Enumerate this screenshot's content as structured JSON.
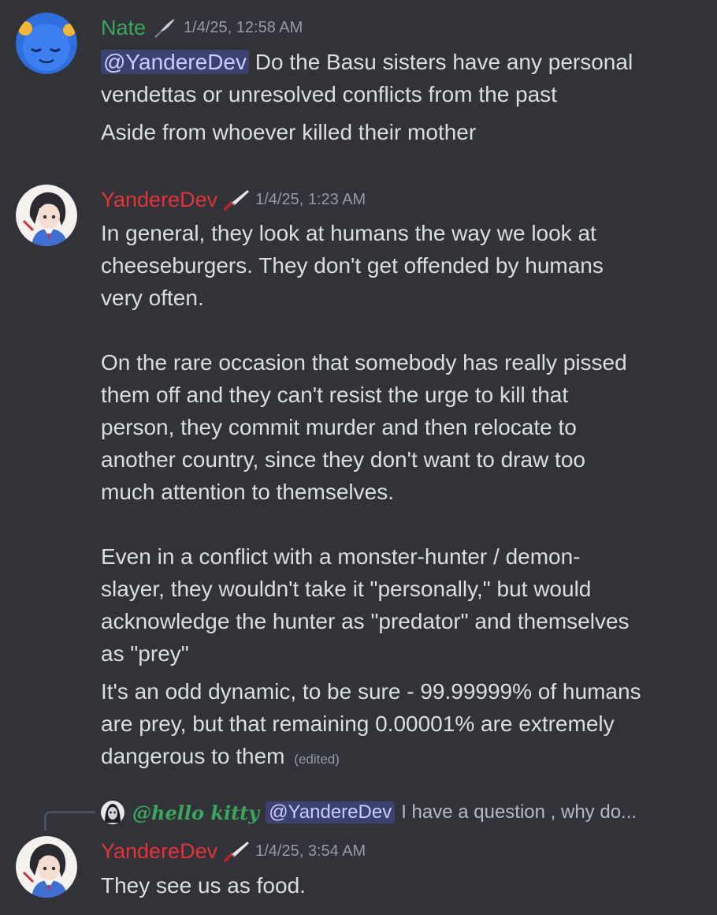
{
  "colors": {
    "background": "#313338",
    "nate_name": "#3ba55d",
    "yanderedev_name": "#e0343a",
    "reply_name": "#3ba55d",
    "mention_bg": "#4b4f8c",
    "text": "#dbdee1",
    "muted": "#949ba4"
  },
  "messages": [
    {
      "author": "Nate",
      "role_icon": "feather-quill-icon",
      "timestamp": "1/4/25, 12:58 AM",
      "mention": "@YandereDev",
      "lines": [
        "Do the Basu sisters have any personal",
        "vendettas or unresolved conflicts from the past",
        "Aside from whoever killed their mother"
      ]
    },
    {
      "author": "YandereDev",
      "role_icon": "knife-icon",
      "timestamp": "1/4/25, 1:23 AM",
      "lines": [
        "In general, they look at humans the way we look at",
        "cheeseburgers. They don't get offended by humans",
        "very often.",
        "",
        "On the rare occasion that somebody has really pissed",
        "them off and they can't resist the urge to kill that",
        "person, they commit murder and then relocate to",
        "another country, since they don't want to draw too",
        "much attention to themselves.",
        "",
        "Even in a conflict with a monster-hunter / demon-",
        "slayer, they wouldn't take it \"personally,\" but would",
        "acknowledge the hunter as \"predator\" and themselves",
        "as \"prey\"",
        "It's an odd dynamic, to be sure - 99.99999% of humans",
        "are prey, but that remaining 0.00001% are extremely",
        "dangerous to them"
      ],
      "edited_label": "(edited)"
    },
    {
      "reply": {
        "author": "@hello kitty",
        "mention": "@YandereDev",
        "preview": "I have a question , why do..."
      },
      "author": "YandereDev",
      "role_icon": "knife-icon",
      "timestamp": "1/4/25, 3:54 AM",
      "lines": [
        "They see us as food."
      ]
    }
  ]
}
